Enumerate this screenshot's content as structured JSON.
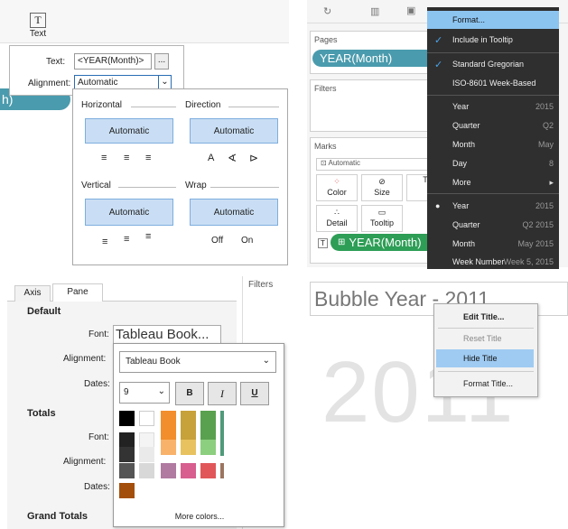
{
  "q1": {
    "text_tool_label": "Text",
    "text_field_label": "Text:",
    "text_field_value": "<YEAR(Month)>",
    "more_button": "...",
    "alignment_label": "Alignment:",
    "alignment_value": "Automatic",
    "pill_fragment": "h)",
    "horizontal_label": "Horizontal",
    "direction_label": "Direction",
    "vertical_label": "Vertical",
    "wrap_label": "Wrap",
    "h_auto": "Automatic",
    "d_auto": "Automatic",
    "v_auto": "Automatic",
    "w_auto": "Automatic",
    "direction_a": "A",
    "wrap_off": "Off",
    "wrap_on": "On"
  },
  "q2": {
    "pages_label": "Pages",
    "pages_pill": "YEAR(Month)",
    "filters_label": "Filters",
    "marks_label": "Marks",
    "marks_type": "Automatic",
    "color_label": "Color",
    "size_label": "Size",
    "detail_label": "Detail",
    "tooltip_label": "Tooltip",
    "t_partial": "T",
    "marks_pill": "YEAR(Month)",
    "menu": {
      "format": "Format...",
      "include_tooltip": "Include in Tooltip",
      "standard_gregorian": "Standard Gregorian",
      "iso_week": "ISO-8601 Week-Based",
      "year": "Year",
      "year_val": "2015",
      "quarter": "Quarter",
      "quarter_val": "Q2",
      "month": "Month",
      "month_val": "May",
      "day": "Day",
      "day_val": "8",
      "more": "More",
      "year2": "Year",
      "year2_val": "2015",
      "quarter2": "Quarter",
      "quarter2_val": "Q2 2015",
      "month2": "Month",
      "month2_val": "May 2015",
      "week": "Week Number",
      "week_val": "Week 5, 2015"
    }
  },
  "q3": {
    "tab_axis": "Axis",
    "tab_pane": "Pane",
    "filters_label": "Filters",
    "default_header": "Default",
    "font_label": "Font:",
    "font_value": "Tableau Book...",
    "alignment_label": "Alignment:",
    "dates_label": "Dates:",
    "totals_header": "Totals",
    "font_label2": "Font:",
    "alignment_label2": "Alignment:",
    "dates_label2": "Dates:",
    "grand_totals_header": "Grand Totals",
    "font_select": "Tableau Book",
    "font_size": "9",
    "bold": "B",
    "italic": "I",
    "underline": "U",
    "more_colors": "More colors...",
    "colors": {
      "black": "#000000",
      "white": "#ffffff",
      "orange": "#f28e2b",
      "gold": "#c7a13a",
      "green": "#59a14f",
      "pink": "#b07aa1",
      "rose": "#d75e8f",
      "red": "#e15759",
      "brown": "#a34f0b"
    }
  },
  "q4": {
    "title": "Bubble Year - 2011",
    "watermark": "2011",
    "menu": {
      "edit_title": "Edit Title...",
      "reset_title": "Reset Title",
      "hide_title": "Hide Title",
      "format_title": "Format Title..."
    }
  }
}
